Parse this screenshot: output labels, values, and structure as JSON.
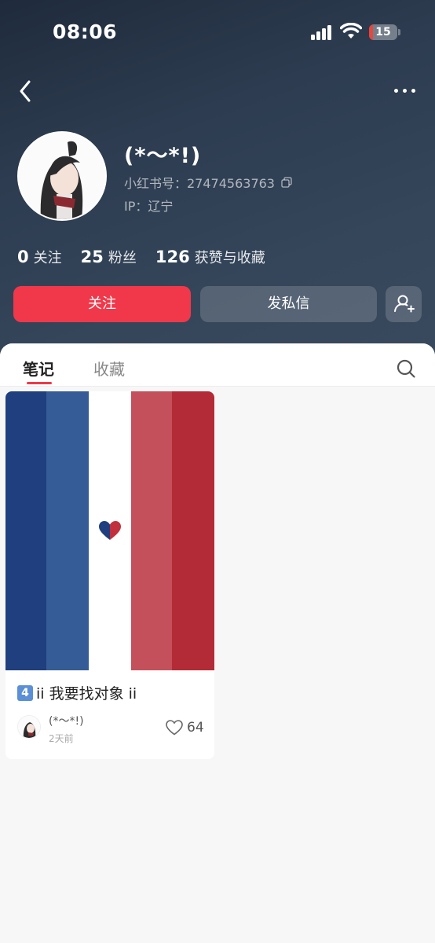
{
  "status_bar": {
    "time": "08:06",
    "battery": "15",
    "battery_level": 0.15
  },
  "profile": {
    "name": "(*～*!)",
    "id_label": "小红书号：2747456376​3",
    "ip_label": "IP：辽宁"
  },
  "stats": [
    {
      "value": "0",
      "label": "关注"
    },
    {
      "value": "25",
      "label": "粉丝"
    },
    {
      "value": "126",
      "label": "获赞与收藏"
    }
  ],
  "actions": {
    "follow": "关注",
    "message": "发私信"
  },
  "tabs": [
    {
      "label": "笔记"
    },
    {
      "label": "收藏"
    }
  ],
  "notes": [
    {
      "badge": "4",
      "title": "ii 我要找对象 ii",
      "author": "(*～*!)",
      "time": "2天前",
      "likes": "64",
      "flag_colors": [
        "#1f3f7e",
        "#355c96",
        "#ffffff",
        "#c3505a",
        "#b32b36"
      ]
    }
  ],
  "colors": {
    "accent": "#f0384a",
    "header_bg": "#2d3c50"
  }
}
